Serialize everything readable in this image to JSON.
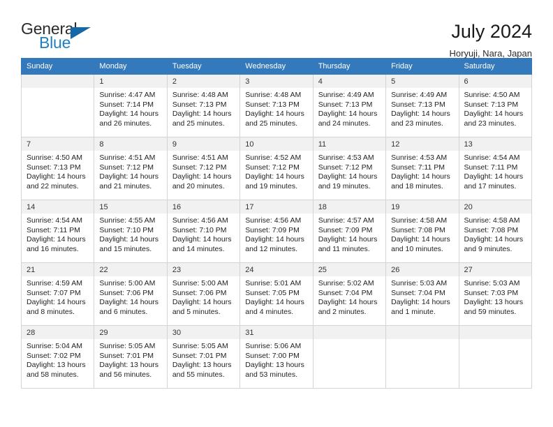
{
  "brand": {
    "word_one": "General",
    "word_two": "Blue",
    "triangle_color": "#1468a8",
    "blue_color": "#1f7fc4",
    "logo_icon": "triangle-flag-icon"
  },
  "header": {
    "title": "July 2024",
    "subtitle": "Horyuji, Nara, Japan"
  },
  "calendar": {
    "header_bg": "#3479bb",
    "weekdays": [
      "Sunday",
      "Monday",
      "Tuesday",
      "Wednesday",
      "Thursday",
      "Friday",
      "Saturday"
    ],
    "weeks": [
      [
        {
          "day": "",
          "lines": []
        },
        {
          "day": "1",
          "lines": [
            "Sunrise: 4:47 AM",
            "Sunset: 7:14 PM",
            "Daylight: 14 hours",
            "and 26 minutes."
          ]
        },
        {
          "day": "2",
          "lines": [
            "Sunrise: 4:48 AM",
            "Sunset: 7:13 PM",
            "Daylight: 14 hours",
            "and 25 minutes."
          ]
        },
        {
          "day": "3",
          "lines": [
            "Sunrise: 4:48 AM",
            "Sunset: 7:13 PM",
            "Daylight: 14 hours",
            "and 25 minutes."
          ]
        },
        {
          "day": "4",
          "lines": [
            "Sunrise: 4:49 AM",
            "Sunset: 7:13 PM",
            "Daylight: 14 hours",
            "and 24 minutes."
          ]
        },
        {
          "day": "5",
          "lines": [
            "Sunrise: 4:49 AM",
            "Sunset: 7:13 PM",
            "Daylight: 14 hours",
            "and 23 minutes."
          ]
        },
        {
          "day": "6",
          "lines": [
            "Sunrise: 4:50 AM",
            "Sunset: 7:13 PM",
            "Daylight: 14 hours",
            "and 23 minutes."
          ]
        }
      ],
      [
        {
          "day": "7",
          "lines": [
            "Sunrise: 4:50 AM",
            "Sunset: 7:13 PM",
            "Daylight: 14 hours",
            "and 22 minutes."
          ]
        },
        {
          "day": "8",
          "lines": [
            "Sunrise: 4:51 AM",
            "Sunset: 7:12 PM",
            "Daylight: 14 hours",
            "and 21 minutes."
          ]
        },
        {
          "day": "9",
          "lines": [
            "Sunrise: 4:51 AM",
            "Sunset: 7:12 PM",
            "Daylight: 14 hours",
            "and 20 minutes."
          ]
        },
        {
          "day": "10",
          "lines": [
            "Sunrise: 4:52 AM",
            "Sunset: 7:12 PM",
            "Daylight: 14 hours",
            "and 19 minutes."
          ]
        },
        {
          "day": "11",
          "lines": [
            "Sunrise: 4:53 AM",
            "Sunset: 7:12 PM",
            "Daylight: 14 hours",
            "and 19 minutes."
          ]
        },
        {
          "day": "12",
          "lines": [
            "Sunrise: 4:53 AM",
            "Sunset: 7:11 PM",
            "Daylight: 14 hours",
            "and 18 minutes."
          ]
        },
        {
          "day": "13",
          "lines": [
            "Sunrise: 4:54 AM",
            "Sunset: 7:11 PM",
            "Daylight: 14 hours",
            "and 17 minutes."
          ]
        }
      ],
      [
        {
          "day": "14",
          "lines": [
            "Sunrise: 4:54 AM",
            "Sunset: 7:11 PM",
            "Daylight: 14 hours",
            "and 16 minutes."
          ]
        },
        {
          "day": "15",
          "lines": [
            "Sunrise: 4:55 AM",
            "Sunset: 7:10 PM",
            "Daylight: 14 hours",
            "and 15 minutes."
          ]
        },
        {
          "day": "16",
          "lines": [
            "Sunrise: 4:56 AM",
            "Sunset: 7:10 PM",
            "Daylight: 14 hours",
            "and 14 minutes."
          ]
        },
        {
          "day": "17",
          "lines": [
            "Sunrise: 4:56 AM",
            "Sunset: 7:09 PM",
            "Daylight: 14 hours",
            "and 12 minutes."
          ]
        },
        {
          "day": "18",
          "lines": [
            "Sunrise: 4:57 AM",
            "Sunset: 7:09 PM",
            "Daylight: 14 hours",
            "and 11 minutes."
          ]
        },
        {
          "day": "19",
          "lines": [
            "Sunrise: 4:58 AM",
            "Sunset: 7:08 PM",
            "Daylight: 14 hours",
            "and 10 minutes."
          ]
        },
        {
          "day": "20",
          "lines": [
            "Sunrise: 4:58 AM",
            "Sunset: 7:08 PM",
            "Daylight: 14 hours",
            "and 9 minutes."
          ]
        }
      ],
      [
        {
          "day": "21",
          "lines": [
            "Sunrise: 4:59 AM",
            "Sunset: 7:07 PM",
            "Daylight: 14 hours",
            "and 8 minutes."
          ]
        },
        {
          "day": "22",
          "lines": [
            "Sunrise: 5:00 AM",
            "Sunset: 7:06 PM",
            "Daylight: 14 hours",
            "and 6 minutes."
          ]
        },
        {
          "day": "23",
          "lines": [
            "Sunrise: 5:00 AM",
            "Sunset: 7:06 PM",
            "Daylight: 14 hours",
            "and 5 minutes."
          ]
        },
        {
          "day": "24",
          "lines": [
            "Sunrise: 5:01 AM",
            "Sunset: 7:05 PM",
            "Daylight: 14 hours",
            "and 4 minutes."
          ]
        },
        {
          "day": "25",
          "lines": [
            "Sunrise: 5:02 AM",
            "Sunset: 7:04 PM",
            "Daylight: 14 hours",
            "and 2 minutes."
          ]
        },
        {
          "day": "26",
          "lines": [
            "Sunrise: 5:03 AM",
            "Sunset: 7:04 PM",
            "Daylight: 14 hours",
            "and 1 minute."
          ]
        },
        {
          "day": "27",
          "lines": [
            "Sunrise: 5:03 AM",
            "Sunset: 7:03 PM",
            "Daylight: 13 hours",
            "and 59 minutes."
          ]
        }
      ],
      [
        {
          "day": "28",
          "lines": [
            "Sunrise: 5:04 AM",
            "Sunset: 7:02 PM",
            "Daylight: 13 hours",
            "and 58 minutes."
          ]
        },
        {
          "day": "29",
          "lines": [
            "Sunrise: 5:05 AM",
            "Sunset: 7:01 PM",
            "Daylight: 13 hours",
            "and 56 minutes."
          ]
        },
        {
          "day": "30",
          "lines": [
            "Sunrise: 5:05 AM",
            "Sunset: 7:01 PM",
            "Daylight: 13 hours",
            "and 55 minutes."
          ]
        },
        {
          "day": "31",
          "lines": [
            "Sunrise: 5:06 AM",
            "Sunset: 7:00 PM",
            "Daylight: 13 hours",
            "and 53 minutes."
          ]
        },
        {
          "day": "",
          "lines": []
        },
        {
          "day": "",
          "lines": []
        },
        {
          "day": "",
          "lines": []
        }
      ]
    ]
  }
}
